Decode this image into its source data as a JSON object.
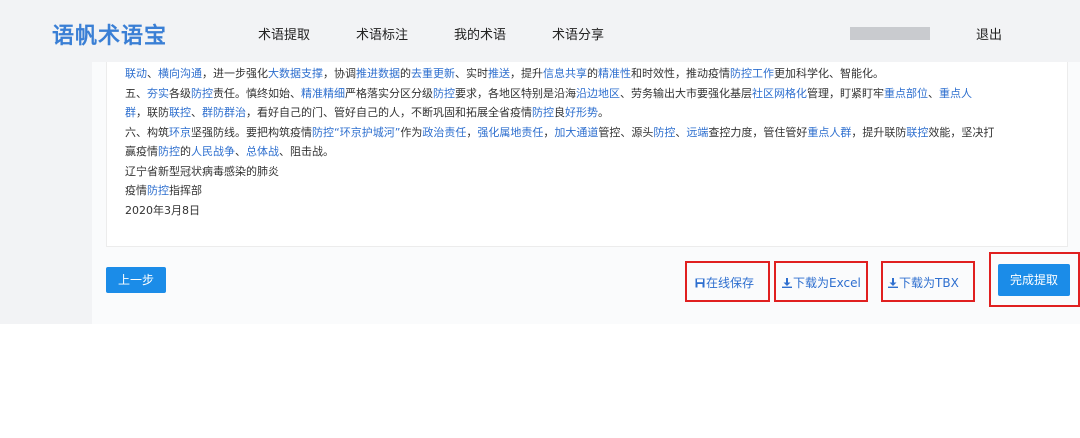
{
  "header": {
    "brand": "语帆术语宝",
    "nav": [
      "术语提取",
      "术语标注",
      "我的术语",
      "术语分享"
    ],
    "logout": "退出"
  },
  "doc": {
    "lines": [
      [
        [
          "联动",
          1
        ],
        [
          "、",
          0
        ],
        [
          "横向沟通",
          1
        ],
        [
          "，进一步强化",
          0
        ],
        [
          "大数据支撑",
          1
        ],
        [
          "，协调",
          0
        ],
        [
          "推进数据",
          1
        ],
        [
          "的",
          0
        ],
        [
          "去重更新",
          1
        ],
        [
          "、实时",
          0
        ],
        [
          "推送",
          1
        ],
        [
          "，提升",
          0
        ],
        [
          "信息共享",
          1
        ],
        [
          "的",
          0
        ],
        [
          "精准性",
          1
        ],
        [
          "和时效性，推动疫情",
          0
        ],
        [
          "防控工作",
          1
        ],
        [
          "更加科学化、智能化。",
          0
        ]
      ],
      [
        [
          "五、",
          0
        ],
        [
          "夯实",
          1
        ],
        [
          "各级",
          0
        ],
        [
          "防控",
          1
        ],
        [
          "责任。慎终如始、",
          0
        ],
        [
          "精准精细",
          1
        ],
        [
          "严格落实分区分级",
          0
        ],
        [
          "防控",
          1
        ],
        [
          "要求，各地区特别是沿海",
          0
        ],
        [
          "沿边地区",
          1
        ],
        [
          "、劳务输出大市要强化基层",
          0
        ],
        [
          "社区网格化",
          1
        ],
        [
          "管理，盯紧盯牢",
          0
        ],
        [
          "重点部位",
          1
        ],
        [
          "、",
          0
        ],
        [
          "重点人",
          1
        ]
      ],
      [
        [
          "群",
          1
        ],
        [
          "，联防",
          0
        ],
        [
          "联控",
          1
        ],
        [
          "、",
          0
        ],
        [
          "群防群治",
          1
        ],
        [
          "，看好自己的门、管好自己的人，不断巩固和拓展全省疫情",
          0
        ],
        [
          "防控",
          1
        ],
        [
          "良",
          0
        ],
        [
          "好形势",
          1
        ],
        [
          "。",
          0
        ]
      ],
      [
        [
          "六、构筑",
          0
        ],
        [
          "环京",
          1
        ],
        [
          "坚强防线。要把构筑疫情",
          0
        ],
        [
          "防控",
          1
        ],
        [
          "“环京护城河”",
          1
        ],
        [
          "作为",
          0
        ],
        [
          "政治责任",
          1
        ],
        [
          "，",
          0
        ],
        [
          "强化属地责任",
          1
        ],
        [
          "，",
          0
        ],
        [
          "加大通道",
          1
        ],
        [
          "管控、源头",
          0
        ],
        [
          "防控",
          1
        ],
        [
          "、",
          0
        ],
        [
          "远端",
          1
        ],
        [
          "查控力度，管住管好",
          0
        ],
        [
          "重点人群",
          1
        ],
        [
          "，提升联防",
          0
        ],
        [
          "联控",
          1
        ],
        [
          "效能，坚决打",
          0
        ]
      ],
      [
        [
          "赢疫情",
          0
        ],
        [
          "防控",
          1
        ],
        [
          "的",
          0
        ],
        [
          "人民战争",
          1
        ],
        [
          "、",
          0
        ],
        [
          "总体战",
          1
        ],
        [
          "、阻击战。",
          0
        ]
      ],
      [
        [
          "辽宁省新型冠状病毒感染的肺炎",
          0
        ]
      ],
      [
        [
          "疫情",
          0
        ],
        [
          "防控",
          1
        ],
        [
          "指挥部",
          0
        ]
      ],
      [
        [
          "2020年3月8日",
          0
        ]
      ]
    ]
  },
  "buttons": {
    "prev": "上一步",
    "save": "在线保存",
    "excel": "下载为Excel",
    "tbx": "下载为TBX",
    "finish": "完成提取"
  },
  "colors": {
    "brand": "#3a7fd5",
    "term": "#2e6fcf",
    "primary": "#1b8ce8",
    "highlight_box": "#e02020"
  },
  "icons": {
    "save": "save-icon",
    "excel": "download-icon",
    "tbx": "download-icon"
  }
}
